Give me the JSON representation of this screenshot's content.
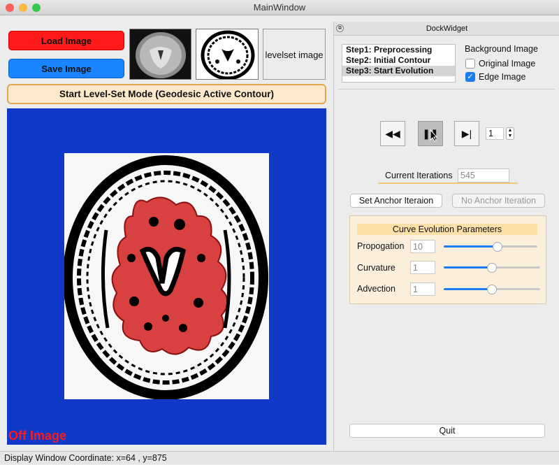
{
  "window": {
    "title": "MainWindow"
  },
  "left": {
    "load_label": "Load Image",
    "save_label": "Save Image",
    "levelset_label": "levelset image",
    "start_mode_label": "Start Level-Set Mode (Geodesic Active Contour)",
    "off_image_label": "Off Image"
  },
  "status": {
    "text": "Display Window Coordinate: x=64 , y=875"
  },
  "dock": {
    "title": "DockWidget",
    "steps": [
      "Step1: Preprocessing",
      "Step2: Initial Contour",
      "Step3: Start Evolution"
    ],
    "selected_step": "Step3: Start Evolution",
    "background": {
      "label": "Background Image",
      "original_label": "Original Image",
      "original_checked": false,
      "edge_label": "Edge Image",
      "edge_checked": true
    },
    "playback": {
      "step_value": "1"
    },
    "current_iterations_label": "Current Iterations",
    "current_iterations_value": "545",
    "set_anchor_label": "Set Anchor Iteraion",
    "no_anchor_label": "No Anchor Iteration",
    "params": {
      "title": "Curve Evolution Parameters",
      "propogation_label": "Propogation",
      "propogation_value": "10",
      "propogation_level": 0.58,
      "curvature_label": "Curvature",
      "curvature_value": "1",
      "curvature_level": 0.5,
      "advection_label": "Advection",
      "advection_value": "1",
      "advection_level": 0.5
    },
    "quit_label": "Quit"
  },
  "colors": {
    "load_button": "#ff1a1a",
    "save_button": "#1a85ff",
    "display_background": "#1039c8",
    "contour_fill": "#d94040",
    "accent": "#1a7ef2"
  }
}
